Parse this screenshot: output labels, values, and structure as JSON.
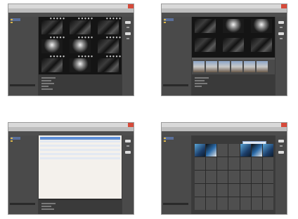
{
  "windows": [
    {
      "title": "",
      "menu": [
        "",
        "",
        "",
        "",
        ""
      ],
      "view": "thumbnails"
    },
    {
      "title": "",
      "menu": [
        "",
        "",
        "",
        "",
        ""
      ],
      "view": "thumbnails-strip"
    },
    {
      "title": "",
      "menu": [
        "",
        "",
        "",
        "",
        ""
      ],
      "view": "table"
    },
    {
      "title": "",
      "menu": [
        "",
        "",
        "",
        "",
        ""
      ],
      "view": "calendar"
    }
  ],
  "colors": {
    "accent": "#5d8fd8",
    "close": "#d64a3a",
    "folder": "#d9b54a",
    "sidebar": "#4a4a4a",
    "thumb_bg": "#141414"
  },
  "icons": [
    "folder-icon",
    "close-icon"
  ]
}
